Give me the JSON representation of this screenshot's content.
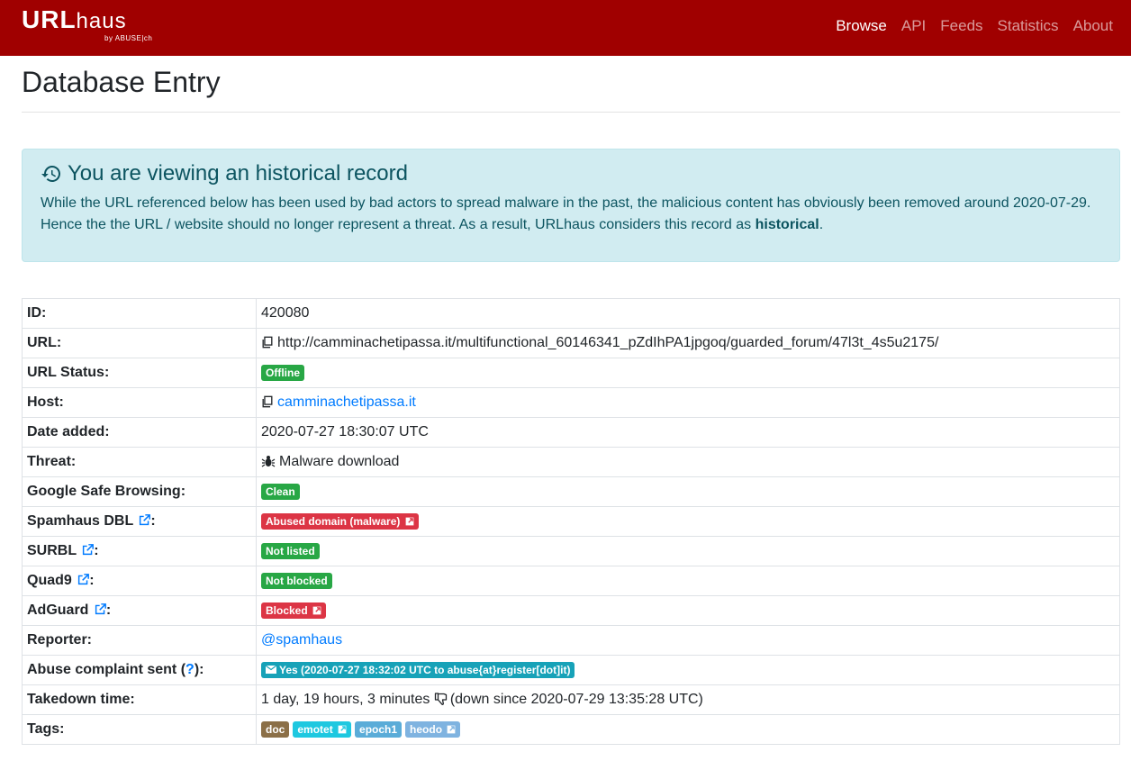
{
  "nav": {
    "logo_main_bold": "URL",
    "logo_main_light": "haus",
    "logo_sub": "by ABUSE|ch",
    "links": [
      "Browse",
      "API",
      "Feeds",
      "Statistics",
      "About"
    ]
  },
  "page_title": "Database Entry",
  "alert": {
    "title": "You are viewing an historical record",
    "body_pre": "While the URL referenced below has been used by bad actors to spread malware in the past, the malicious content has obviously been removed around 2020-07-29. Hence the the URL / website should no longer represent a threat. As a result, URLhaus considers this record as ",
    "body_bold": "historical",
    "body_post": "."
  },
  "entry": {
    "id_label": "ID:",
    "id": "420080",
    "url_label": "URL:",
    "url": "http://camminachetipassa.it/multifunctional_60146341_pZdIhPA1jpgoq/guarded_forum/47l3t_4s5u2175/",
    "status_label": "URL Status:",
    "status": "Offline",
    "host_label": "Host:",
    "host": "camminachetipassa.it",
    "date_label": "Date added:",
    "date": "2020-07-27 18:30:07 UTC",
    "threat_label": "Threat:",
    "threat": "Malware download",
    "gsb_label": "Google Safe Browsing:",
    "gsb": "Clean",
    "spamhaus_label": "Spamhaus DBL",
    "spamhaus": "Abused domain (malware)",
    "surbl_label": "SURBL",
    "surbl": "Not listed",
    "quad9_label": "Quad9",
    "quad9": "Not blocked",
    "adguard_label": "AdGuard",
    "adguard": "Blocked",
    "reporter_label": "Reporter:",
    "reporter": "@spamhaus",
    "abuse_label_pre": "Abuse complaint sent (",
    "abuse_label_q": "?",
    "abuse_label_post": "):",
    "abuse": "Yes (2020-07-27 18:32:02 UTC to abuse{at}register[dot]it)",
    "takedown_label": "Takedown time:",
    "takedown_time": "1 day, 19 hours, 3 minutes",
    "takedown_since": "(down since 2020-07-29 13:35:28 UTC)",
    "tags_label": "Tags:",
    "tags": [
      "doc",
      "emotet",
      "epoch1",
      "heodo"
    ]
  },
  "colors": {
    "navbar": "#a00000",
    "link": "#007bff",
    "green": "#28a745",
    "red": "#dc3545",
    "info": "#17a2b8"
  }
}
